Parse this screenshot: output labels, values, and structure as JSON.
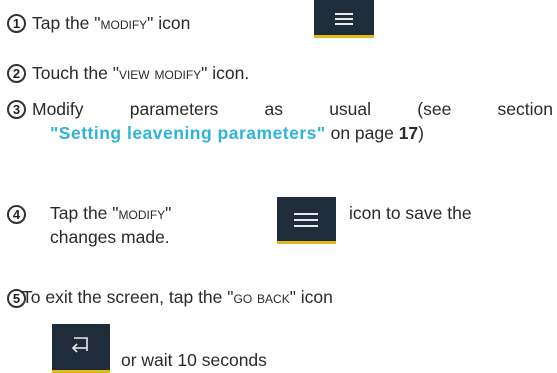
{
  "steps": [
    {
      "number": "1",
      "prefix": "Tap the \"",
      "keyword": "MODIFY",
      "suffix": "\" icon"
    },
    {
      "number": "2",
      "prefix": "Touch the \"",
      "keyword": "VIEW MODIFY",
      "suffix": "\" icon."
    },
    {
      "number": "3",
      "line1_words": [
        "Modify",
        "parameters",
        "as",
        "usual",
        "(see",
        "section"
      ],
      "link_text": "\"Setting leavening parameters\"",
      "line2_mid": " on page ",
      "page": "17",
      "line2_end": ")"
    },
    {
      "number": "4",
      "prefix": "Tap the \"",
      "keyword": "MODIFY",
      "suffix": "\"",
      "after_icon": "icon to save the",
      "line2": "changes made."
    },
    {
      "number": "5",
      "prefix": "To exit the screen, tap the \"",
      "keyword": "GO BACK",
      "suffix": "\" icon",
      "line2": "or wait 10 seconds"
    }
  ],
  "icons": {
    "modify": "hamburger-menu-icon",
    "go_back": "back-arrow-icon",
    "background": "#1f2d3a",
    "underline": "#e3b71e"
  },
  "colors": {
    "link": "#2fb4d8",
    "text": "#2a2a2a"
  }
}
